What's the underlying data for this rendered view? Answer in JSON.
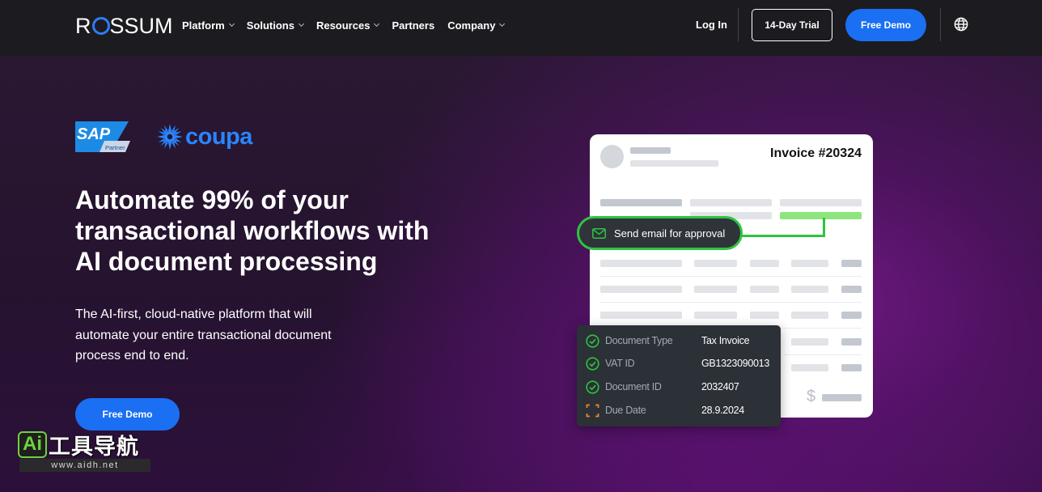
{
  "nav": {
    "logo": "ROSSUM",
    "menu": [
      {
        "label": "Platform",
        "dropdown": true
      },
      {
        "label": "Solutions",
        "dropdown": true
      },
      {
        "label": "Resources",
        "dropdown": true
      },
      {
        "label": "Partners",
        "dropdown": false
      },
      {
        "label": "Company",
        "dropdown": true
      }
    ],
    "login": "Log In",
    "trial": "14-Day Trial",
    "demo": "Free Demo",
    "language_icon": "globe-icon"
  },
  "hero": {
    "partners": {
      "sap_text": "SAP",
      "sap_sub": "Partner",
      "coupa": "coupa"
    },
    "headline": "Automate 99% of your transactional workflows with AI document processing",
    "subtext": "The AI-first, cloud-native platform that will automate your entire transactional document process end to end.",
    "cta": "Free Demo"
  },
  "illustration": {
    "invoice_title": "Invoice #20324",
    "send_email": "Send email for approval",
    "currency_symbol": "$",
    "fields": [
      {
        "label": "Document Type",
        "value": "Tax Invoice",
        "status": "done"
      },
      {
        "label": "VAT ID",
        "value": "GB1323090013",
        "status": "done"
      },
      {
        "label": "Document ID",
        "value": "2032407",
        "status": "done"
      },
      {
        "label": "Due Date",
        "value": "28.9.2024",
        "status": "pending"
      }
    ],
    "colors": {
      "accent_green": "#2ec43f",
      "pending_orange": "#e8892a",
      "brand_blue": "#1a6ff2"
    }
  },
  "watermark": {
    "badge": "Ai",
    "title": "工具导航",
    "url": "www.aidh.net"
  }
}
